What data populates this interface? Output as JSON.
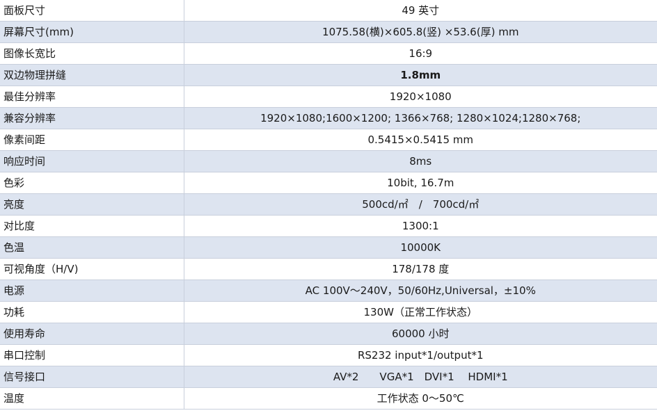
{
  "spec_rows": [
    {
      "label": "面板尺寸",
      "value": "49 英寸"
    },
    {
      "label": "屏幕尺寸(mm)",
      "value": "1075.58(横)×605.8(竖) ×53.6(厚) mm"
    },
    {
      "label": "图像长宽比",
      "value": "16:9"
    },
    {
      "label": "双边物理拼缝",
      "value": "1.8mm"
    },
    {
      "label": "最佳分辨率",
      "value": "1920×1080"
    },
    {
      "label": "兼容分辨率",
      "value": "1920×1080;1600×1200; 1366×768; 1280×1024;1280×768;"
    },
    {
      "label": "像素间距",
      "value": "0.5415×0.5415 mm"
    },
    {
      "label": "响应时间",
      "value": "8ms"
    },
    {
      "label": "色彩",
      "value": "10bit, 16.7m"
    },
    {
      "label": "亮度",
      "value": "500cd/㎡　/　700cd/㎡"
    },
    {
      "label": "对比度",
      "value": "1300:1"
    },
    {
      "label": "色温",
      "value": "10000K"
    },
    {
      "label": "可视角度（H/V)",
      "value": "178/178 度"
    },
    {
      "label": "电源",
      "value": "AC 100V～240V，50/60Hz,Universal，±10%"
    },
    {
      "label": "功耗",
      "value": "130W（正常工作状态）"
    },
    {
      "label": "使用寿命",
      "value": "60000 小时"
    },
    {
      "label": "串口控制",
      "value": "RS232 input*1/output*1"
    },
    {
      "label": "信号接口",
      "value": "AV*2　　VGA*1　DVI*1　 HDMI*1"
    },
    {
      "label": "温度",
      "value": "工作状态 0～50℃"
    }
  ]
}
